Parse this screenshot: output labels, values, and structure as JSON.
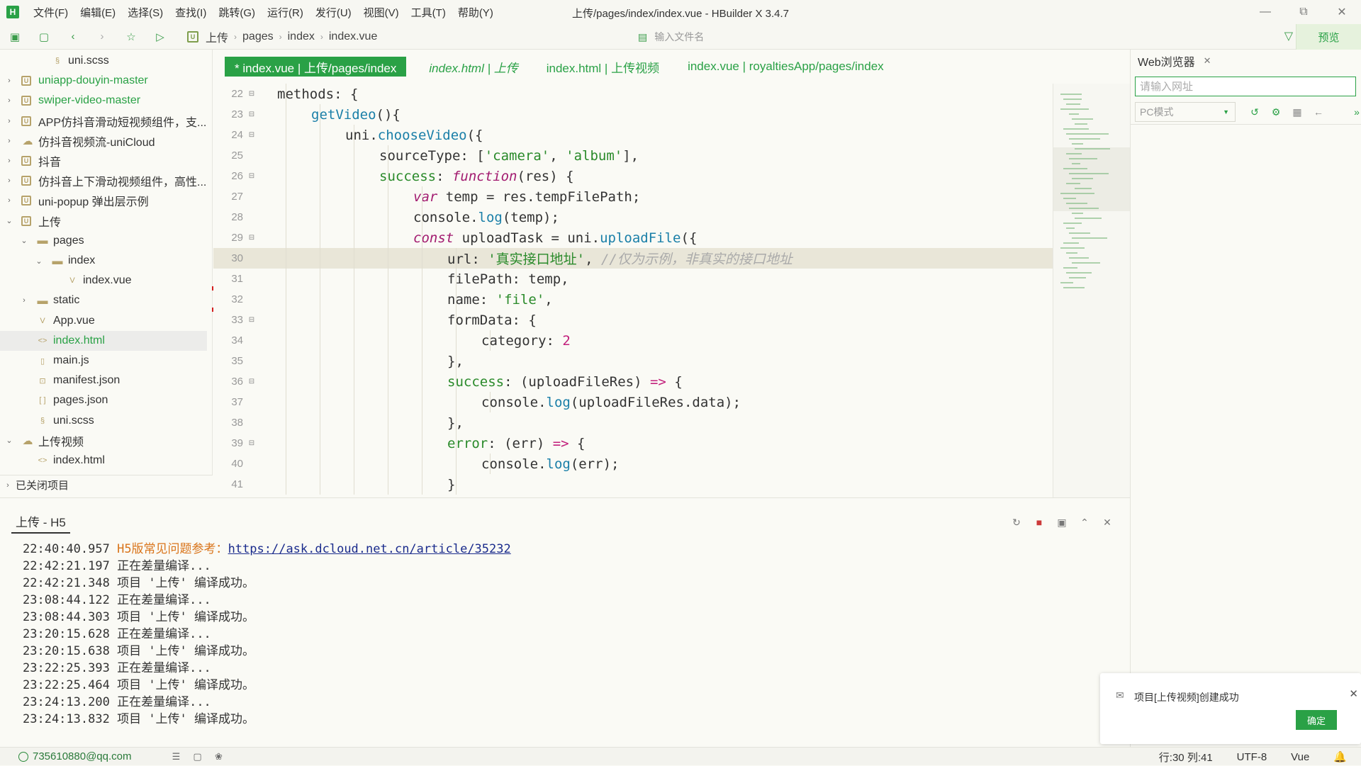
{
  "app": {
    "logo": "H",
    "window_title": "上传/pages/index/index.vue - HBuilder X 3.4.7"
  },
  "menu": [
    "文件(F)",
    "编辑(E)",
    "选择(S)",
    "查找(I)",
    "跳转(G)",
    "运行(R)",
    "发行(U)",
    "视图(V)",
    "工具(T)",
    "帮助(Y)"
  ],
  "toolbar": {
    "breadcrumb": [
      "上传",
      "pages",
      "index",
      "index.vue"
    ],
    "file_search_placeholder": "输入文件名",
    "preview_label": "预览"
  },
  "sidebar": {
    "items": [
      {
        "label": "uni.scss",
        "icon": "scss-file-icon",
        "kind": "file"
      },
      {
        "label": "uniapp-douyin-master",
        "icon": "project-icon",
        "kind": "project",
        "green": true
      },
      {
        "label": "swiper-video-master",
        "icon": "project-icon",
        "kind": "project",
        "green": true
      },
      {
        "label": "APP仿抖音滑动短视频组件，支...",
        "icon": "project-icon",
        "kind": "project"
      },
      {
        "label": "仿抖音视频流-uniCloud",
        "icon": "cloud-project-icon",
        "kind": "project"
      },
      {
        "label": "抖音",
        "icon": "project-icon",
        "kind": "project"
      },
      {
        "label": "仿抖音上下滑动视频组件，高性...",
        "icon": "project-icon",
        "kind": "project"
      },
      {
        "label": "uni-popup 弹出层示例",
        "icon": "project-icon",
        "kind": "project"
      },
      {
        "label": "上传",
        "icon": "project-icon",
        "kind": "project"
      },
      {
        "label": "pages",
        "icon": "folder-icon",
        "kind": "folder"
      },
      {
        "label": "index",
        "icon": "folder-icon",
        "kind": "folder"
      },
      {
        "label": "index.vue",
        "icon": "vue-file-icon",
        "kind": "file"
      },
      {
        "label": "static",
        "icon": "folder-icon",
        "kind": "folder"
      },
      {
        "label": "App.vue",
        "icon": "vue-file-icon",
        "kind": "file"
      },
      {
        "label": "index.html",
        "icon": "html-file-icon",
        "kind": "file",
        "green": true,
        "selected": true
      },
      {
        "label": "main.js",
        "icon": "js-file-icon",
        "kind": "file"
      },
      {
        "label": "manifest.json",
        "icon": "manifest-file-icon",
        "kind": "file"
      },
      {
        "label": "pages.json",
        "icon": "json-file-icon",
        "kind": "file"
      },
      {
        "label": "uni.scss",
        "icon": "scss-file-icon",
        "kind": "file"
      },
      {
        "label": "上传视频",
        "icon": "cloud-project-icon",
        "kind": "project"
      },
      {
        "label": "index.html",
        "icon": "html-file-icon",
        "kind": "file"
      }
    ],
    "closed_projects": "已关闭项目"
  },
  "editor": {
    "tabs": [
      {
        "label": "* index.vue | 上传/pages/index",
        "active": true
      },
      {
        "label": "index.html | 上传",
        "italic": true
      },
      {
        "label": "index.html | 上传视频"
      },
      {
        "label": "index.vue | royaltiesApp/pages/index"
      }
    ],
    "lines": [
      {
        "n": "22",
        "fold": true,
        "indent": 2,
        "tokens": [
          [
            "p",
            "methods"
          ],
          [
            "t",
            ": {"
          ]
        ]
      },
      {
        "n": "23",
        "fold": true,
        "indent": 3,
        "tokens": [
          [
            "fn",
            "getVideo"
          ],
          [
            "t",
            "(){"
          ]
        ]
      },
      {
        "n": "24",
        "fold": true,
        "indent": 4,
        "tokens": [
          [
            "t",
            "uni."
          ],
          [
            "fn",
            "chooseVideo"
          ],
          [
            "t",
            "({"
          ]
        ]
      },
      {
        "n": "25",
        "fold": false,
        "indent": 5,
        "tokens": [
          [
            "t",
            "sourceType: ["
          ],
          [
            "str",
            "'camera'"
          ],
          [
            "t",
            ", "
          ],
          [
            "str",
            "'album'"
          ],
          [
            "t",
            "],"
          ]
        ]
      },
      {
        "n": "26",
        "fold": true,
        "indent": 5,
        "tokens": [
          [
            "prop",
            "success"
          ],
          [
            "t",
            ": "
          ],
          [
            "kwi",
            "function"
          ],
          [
            "t",
            "(res) {"
          ]
        ]
      },
      {
        "n": "27",
        "fold": false,
        "indent": 6,
        "tokens": [
          [
            "kwi",
            "var"
          ],
          [
            "t",
            " temp = res.tempFilePath;"
          ]
        ]
      },
      {
        "n": "28",
        "fold": false,
        "indent": 6,
        "tokens": [
          [
            "t",
            "console."
          ],
          [
            "fn",
            "log"
          ],
          [
            "t",
            "(temp);"
          ]
        ]
      },
      {
        "n": "29",
        "fold": true,
        "indent": 6,
        "tokens": [
          [
            "kwi",
            "const"
          ],
          [
            "t",
            " uploadTask = uni."
          ],
          [
            "fn",
            "uploadFile"
          ],
          [
            "t",
            "({"
          ]
        ]
      },
      {
        "n": "30",
        "fold": false,
        "indent": 7,
        "current": true,
        "tokens": [
          [
            "t",
            "url: "
          ],
          [
            "str",
            "'真实接口地址'"
          ],
          [
            "t",
            ", "
          ],
          [
            "cmt",
            "//仅为示例，非真实的接口地址"
          ]
        ]
      },
      {
        "n": "31",
        "fold": false,
        "indent": 7,
        "tokens": [
          [
            "t",
            "filePath: temp,"
          ]
        ]
      },
      {
        "n": "32",
        "fold": false,
        "indent": 7,
        "tokens": [
          [
            "t",
            "name: "
          ],
          [
            "str",
            "'file'"
          ],
          [
            "t",
            ","
          ]
        ]
      },
      {
        "n": "33",
        "fold": true,
        "indent": 7,
        "tokens": [
          [
            "t",
            "formData: {"
          ]
        ]
      },
      {
        "n": "34",
        "fold": false,
        "indent": 8,
        "tokens": [
          [
            "t",
            "category: "
          ],
          [
            "num",
            "2"
          ]
        ]
      },
      {
        "n": "35",
        "fold": false,
        "indent": 7,
        "tokens": [
          [
            "t",
            "},"
          ]
        ]
      },
      {
        "n": "36",
        "fold": true,
        "indent": 7,
        "tokens": [
          [
            "prop",
            "success"
          ],
          [
            "t",
            ": (uploadFileRes) "
          ],
          [
            "kw",
            "=>"
          ],
          [
            "t",
            " {"
          ]
        ]
      },
      {
        "n": "37",
        "fold": false,
        "indent": 8,
        "tokens": [
          [
            "t",
            "console."
          ],
          [
            "fn",
            "log"
          ],
          [
            "t",
            "(uploadFileRes.data);"
          ]
        ]
      },
      {
        "n": "38",
        "fold": false,
        "indent": 7,
        "tokens": [
          [
            "t",
            "},"
          ]
        ]
      },
      {
        "n": "39",
        "fold": true,
        "indent": 7,
        "tokens": [
          [
            "prop",
            "error"
          ],
          [
            "t",
            ": (err) "
          ],
          [
            "kw",
            "=>"
          ],
          [
            "t",
            " {"
          ]
        ]
      },
      {
        "n": "40",
        "fold": false,
        "indent": 8,
        "tokens": [
          [
            "t",
            "console."
          ],
          [
            "fn",
            "log"
          ],
          [
            "t",
            "(err);"
          ]
        ]
      },
      {
        "n": "41",
        "fold": false,
        "indent": 7,
        "tokens": [
          [
            "t",
            "}"
          ]
        ]
      }
    ]
  },
  "browser": {
    "tab_label": "Web浏览器",
    "url_placeholder": "请输入网址",
    "mode_value": "PC模式"
  },
  "console": {
    "tab_label": "上传 - H5",
    "lines": [
      {
        "time": "22:40:40.957",
        "text": "H5版常见问题参考：",
        "link": "https://ask.dcloud.net.cn/article/35232",
        "orange": true
      },
      {
        "time": "22:42:21.197",
        "text": "正在差量编译..."
      },
      {
        "time": "22:42:21.348",
        "text": "项目 '上传' 编译成功。"
      },
      {
        "time": "23:08:44.122",
        "text": "正在差量编译..."
      },
      {
        "time": "23:08:44.303",
        "text": "项目 '上传' 编译成功。"
      },
      {
        "time": "23:20:15.628",
        "text": "正在差量编译..."
      },
      {
        "time": "23:20:15.638",
        "text": "项目 '上传' 编译成功。"
      },
      {
        "time": "23:22:25.393",
        "text": "正在差量编译..."
      },
      {
        "time": "23:22:25.464",
        "text": "项目 '上传' 编译成功。"
      },
      {
        "time": "23:24:13.200",
        "text": "正在差量编译..."
      },
      {
        "time": "23:24:13.832",
        "text": "项目 '上传' 编译成功。"
      }
    ]
  },
  "toast": {
    "message": "项目[上传视频]创建成功",
    "ok_label": "确定"
  },
  "statusbar": {
    "user": "735610880@qq.com",
    "position": "行:30  列:41",
    "encoding": "UTF-8",
    "language": "Vue"
  },
  "colors": {
    "accent": "#2aa146",
    "background": "#fafaf5"
  }
}
